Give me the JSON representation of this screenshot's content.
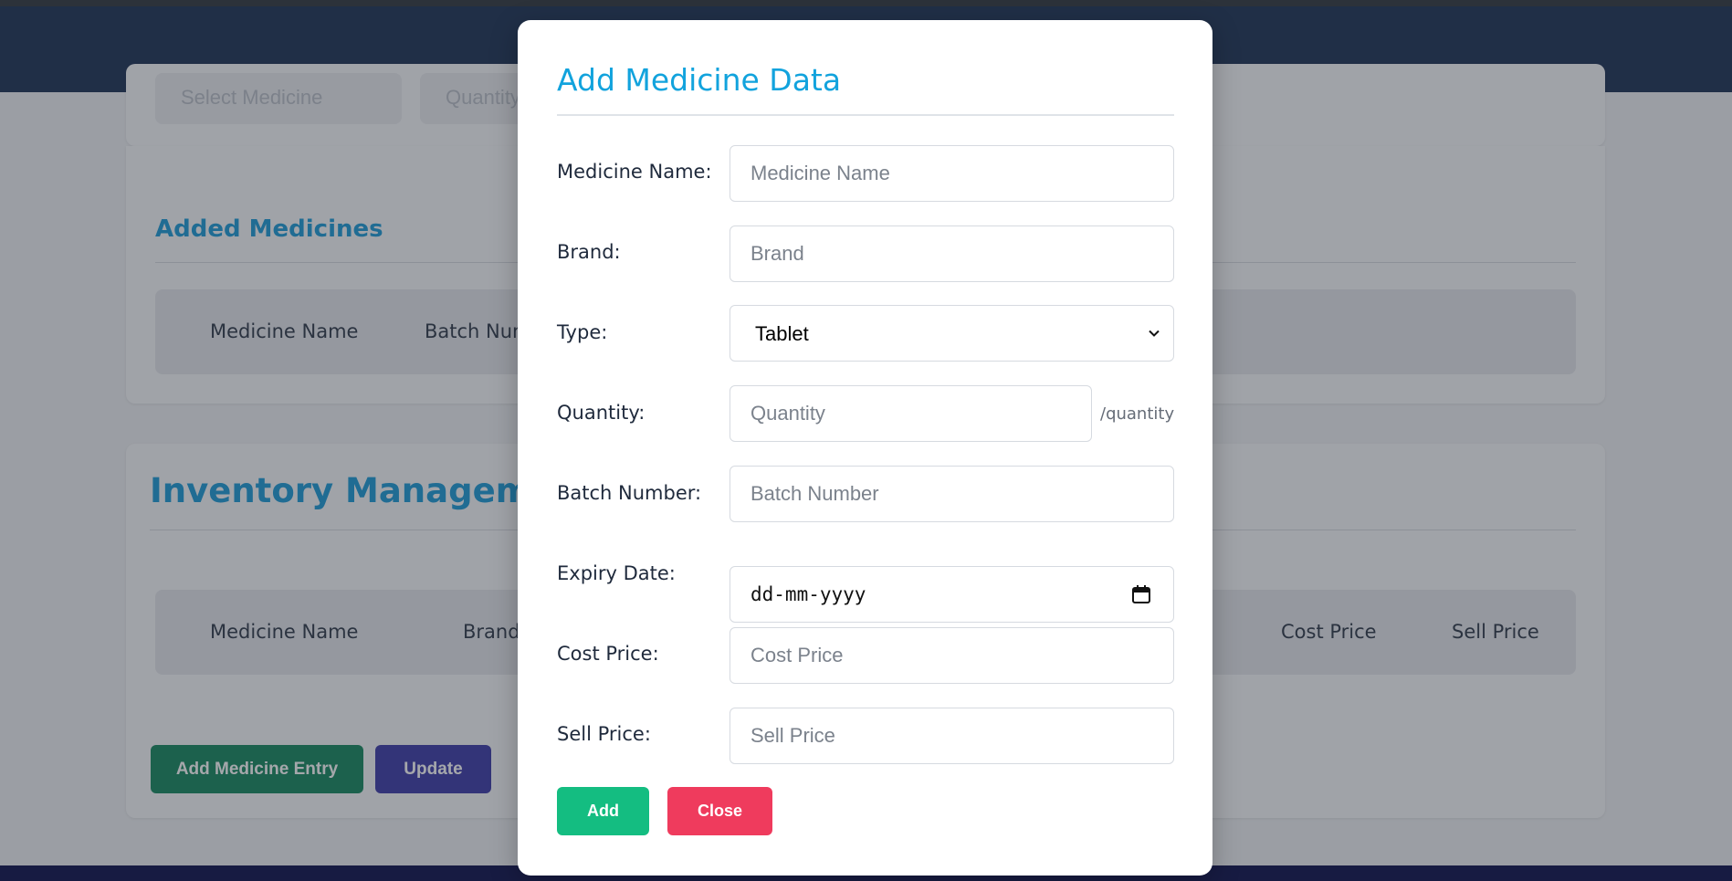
{
  "background": {
    "top_card": {
      "medicine_select_placeholder": "Select Medicine",
      "quantity_placeholder": "Quantity"
    },
    "added_medicines": {
      "title": "Added Medicines",
      "columns": [
        "Medicine Name",
        "Batch Number"
      ]
    },
    "inventory": {
      "title": "Inventory Management",
      "columns": [
        "Medicine Name",
        "Brand",
        "Cost Price",
        "Sell Price"
      ],
      "add_entry_label": "Add Medicine Entry",
      "update_label": "Update"
    }
  },
  "modal": {
    "title": "Add Medicine Data",
    "fields": {
      "medicine_name": {
        "label": "Medicine Name:",
        "placeholder": "Medicine Name"
      },
      "brand": {
        "label": "Brand:",
        "placeholder": "Brand"
      },
      "type": {
        "label": "Type:",
        "value": "Tablet"
      },
      "quantity": {
        "label": "Quantity:",
        "placeholder": "Quantity",
        "unit": "/quantity"
      },
      "batch_number": {
        "label": "Batch Number:",
        "placeholder": "Batch Number"
      },
      "expiry_date": {
        "label": "Expiry Date:",
        "placeholder": "dd-mm-yyyy"
      },
      "cost_price": {
        "label": "Cost Price:",
        "placeholder": "Cost Price"
      },
      "sell_price": {
        "label": "Sell Price:",
        "placeholder": "Sell Price"
      }
    },
    "add_label": "Add",
    "close_label": "Close"
  },
  "colors": {
    "header": "#1b3154",
    "accent_title": "#12a3dd",
    "add_button": "#14bd81",
    "close_button": "#ef3b5d",
    "entry_button": "#13875d",
    "update_button": "#3c3aa8",
    "footer": "#0b0f4a"
  },
  "icons": {
    "select": "chevron-down-icon",
    "date": "calendar-icon"
  }
}
